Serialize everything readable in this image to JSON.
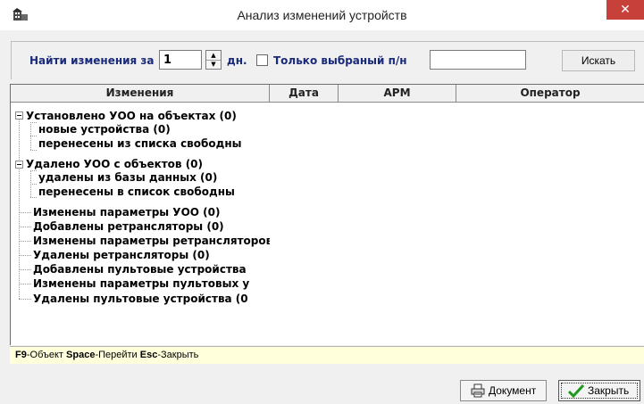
{
  "window": {
    "title": "Анализ изменений устройств",
    "app_icon": "app-icon",
    "close_glyph": "✕"
  },
  "filter": {
    "find_label": "Найти изменения за",
    "days_value": "1",
    "days_unit": "дн.",
    "only_selected_label": "Только выбраный п/н",
    "only_selected_checked": false,
    "number_value": "",
    "search_button": "Искать"
  },
  "grid": {
    "columns": [
      "Изменения",
      "Дата",
      "АРМ",
      "Оператор"
    ],
    "tree": [
      {
        "label": "Установлено УОО на объектах (0)",
        "level": 0,
        "expanded": true
      },
      {
        "label": "новые устройства (0)",
        "level": 1
      },
      {
        "label": "перенесены из списка свободны",
        "level": 1
      },
      {
        "label": "Удалено УОО с объектов (0)",
        "level": 0,
        "expanded": true
      },
      {
        "label": "удалены из базы данных (0)",
        "level": 1
      },
      {
        "label": "перенесены в список свободны",
        "level": 1
      },
      {
        "label": "Изменены параметры УОО (0)",
        "level": 0
      },
      {
        "label": "Добавлены ретрансляторы (0)",
        "level": 0
      },
      {
        "label": "Изменены параметры ретрансляторов",
        "level": 0
      },
      {
        "label": "Удалены ретрансляторы (0)",
        "level": 0
      },
      {
        "label": "Добавлены пультовые устройства",
        "level": 0
      },
      {
        "label": "Изменены параметры пультовых у",
        "level": 0
      },
      {
        "label": "Удалены пультовые устройства (0",
        "level": 0
      }
    ]
  },
  "statusbar": {
    "k1": "F9",
    "t1": "-Объект ",
    "k2": "Space",
    "t2": "-Перейти ",
    "k3": "Esc",
    "t3": "-Закрыть"
  },
  "buttons": {
    "document": "Документ",
    "close": "Закрыть"
  },
  "colors": {
    "close_button": "#c8403a",
    "label_blue": "#1a2a7a",
    "status_bg": "#ffffdc",
    "check_green": "#1e9a1e"
  }
}
